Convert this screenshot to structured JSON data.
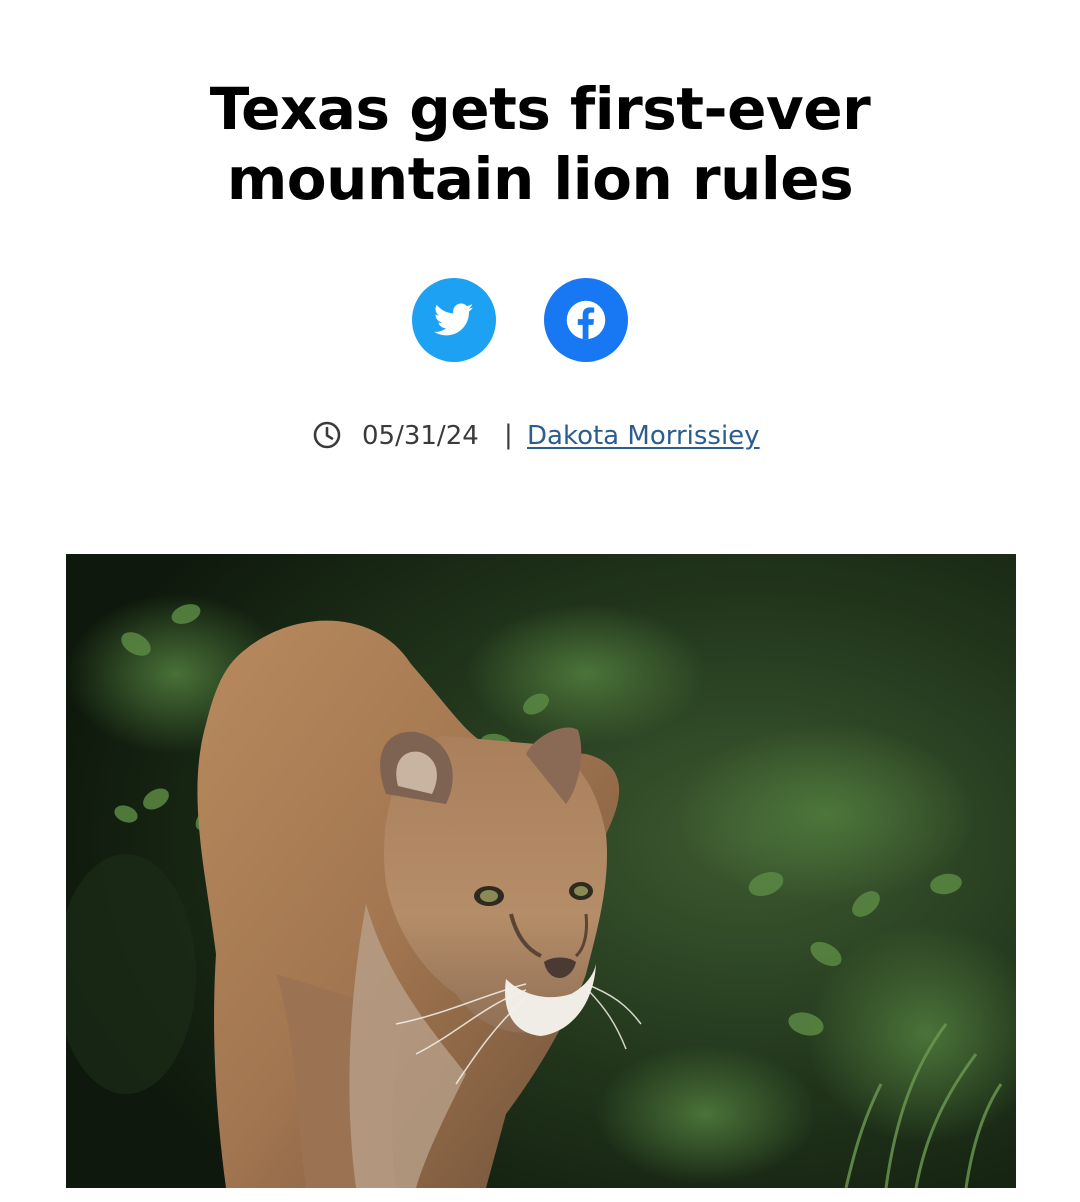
{
  "article": {
    "title": "Texas gets first-ever mountain lion rules",
    "date": "05/31/24",
    "separator": "|",
    "author": "Dakota Morrissiey"
  },
  "share": {
    "twitter_icon": "twitter-icon",
    "facebook_icon": "facebook-icon",
    "twitter_color": "#1da1f2",
    "facebook_color": "#1877f2"
  },
  "meta": {
    "clock_icon": "clock-icon",
    "author_link_color": "#2c5d8f"
  },
  "hero": {
    "subject": "mountain-lion-photo"
  }
}
